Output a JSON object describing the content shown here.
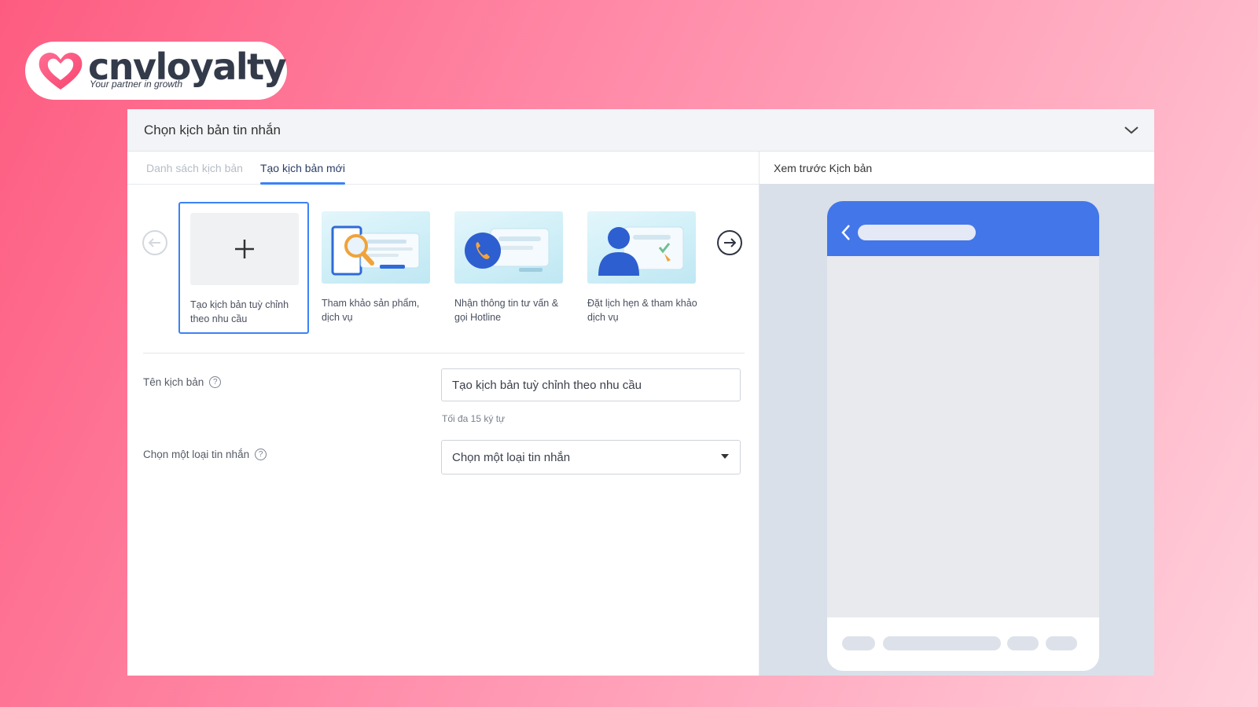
{
  "brand": {
    "name": "cnvloyalty",
    "tagline": "Your partner in growth",
    "accent": "#fd5c80"
  },
  "panel": {
    "title": "Chọn kịch bản tin nhắn",
    "tabs": [
      {
        "label": "Danh sách kịch bản",
        "active": false
      },
      {
        "label": "Tạo kịch bản mới",
        "active": true
      }
    ],
    "templates": [
      {
        "label": "Tạo kịch bản tuỳ chỉnh theo nhu cầu",
        "icon": "plus-icon",
        "selected": true
      },
      {
        "label": "Tham khảo sản phẩm, dịch vụ",
        "icon": "magnifier-product-icon",
        "selected": false
      },
      {
        "label": "Nhận thông tin tư vấn & gọi Hotline",
        "icon": "phone-call-icon",
        "selected": false
      },
      {
        "label": "Đặt lịch hẹn & tham khảo dịch vụ",
        "icon": "appointment-person-icon",
        "selected": false
      }
    ],
    "form": {
      "name_label": "Tên kịch bản",
      "name_value": "Tạo kịch bản tuỳ chỉnh theo nhu cầu",
      "name_hint": "Tối đa 15 ký tự",
      "type_label": "Chọn một loại tin nhắn",
      "type_value": "Chọn một loại tin nhắn"
    },
    "preview_title": "Xem trước Kịch bản",
    "primary_color": "#4376e9"
  }
}
